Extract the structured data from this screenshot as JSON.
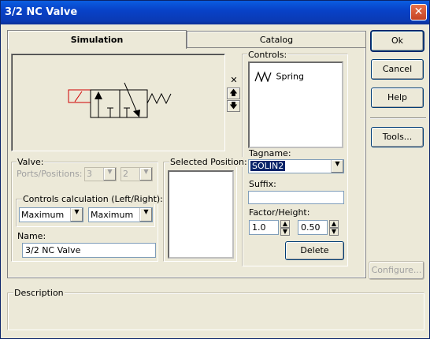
{
  "window": {
    "title": "3/2 NC Valve",
    "close_glyph": "✕"
  },
  "tabs": [
    {
      "label": "Simulation",
      "active": true
    },
    {
      "label": "Catalog",
      "active": false
    }
  ],
  "buttons": {
    "ok": "Ok",
    "cancel": "Cancel",
    "help": "Help",
    "tools": "Tools...",
    "configure": "Configure...",
    "delete": "Delete"
  },
  "reorder": {
    "remove_glyph": "✕",
    "up_glyph": "🡅",
    "down_glyph": "🡇"
  },
  "controls": {
    "legend": "Controls:",
    "items": [
      {
        "icon": "spring-icon",
        "label": "Spring"
      }
    ]
  },
  "tagname": {
    "label": "Tagname:",
    "value": "SOLIN2"
  },
  "suffix": {
    "label": "Suffix:",
    "value": ""
  },
  "factor": {
    "label": "Factor/Height:",
    "factor_value": "1.0",
    "height_value": "0.50"
  },
  "valve": {
    "legend": "Valve:",
    "ports_label": "Ports/Positions:",
    "ports_value": "3",
    "positions_value": "2"
  },
  "controls_calc": {
    "legend": "Controls calculation (Left/Right):",
    "left": "Maximum",
    "right": "Maximum"
  },
  "name": {
    "label": "Name:",
    "value": "3/2 NC Valve"
  },
  "selected_position": {
    "legend": "Selected Position:"
  },
  "description": {
    "legend": "Description",
    "value": ""
  },
  "colors": {
    "title_bar": "#0a3ab4",
    "solenoid": "#d00000",
    "selection": "#0a246a"
  }
}
